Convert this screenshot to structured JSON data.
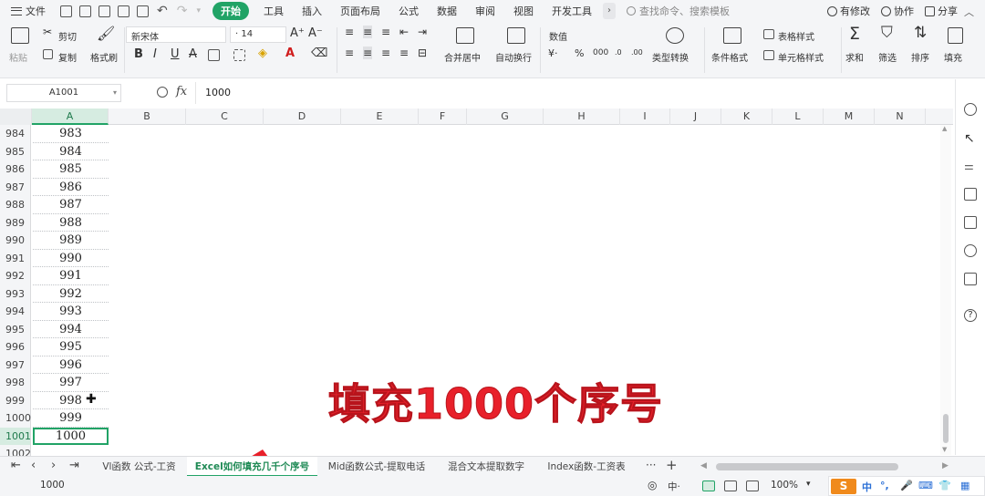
{
  "menubar": {
    "file": "文件",
    "tabs": [
      "开始",
      "工具",
      "插入",
      "页面布局",
      "公式",
      "数据",
      "审阅",
      "视图",
      "开发工具"
    ],
    "search_placeholder": "查找命令、搜索模板",
    "right": [
      "有修改",
      "协作",
      "分享"
    ]
  },
  "ribbon": {
    "paste": "粘贴",
    "cut": "剪切",
    "copy": "复制",
    "format_painter": "格式刷",
    "font_name": "新宋体",
    "font_size": "14",
    "merge_center": "合并居中",
    "wrap_text": "自动换行",
    "number_format": "数值",
    "type_convert": "类型转换",
    "cond_format": "条件格式",
    "table_style": "表格样式",
    "cell_style": "单元格样式",
    "sum": "求和",
    "filter": "筛选",
    "sort": "排序",
    "fill": "填充"
  },
  "formula_bar": {
    "cell_ref": "A1001",
    "fx": "fx",
    "content": "1000"
  },
  "grid": {
    "columns": [
      "A",
      "B",
      "C",
      "D",
      "E",
      "F",
      "G",
      "H",
      "I",
      "J",
      "K",
      "L",
      "M",
      "N"
    ],
    "row_numbers": [
      "984",
      "985",
      "986",
      "987",
      "988",
      "989",
      "990",
      "991",
      "992",
      "993",
      "994",
      "995",
      "996",
      "997",
      "998",
      "999",
      "1000",
      "1001",
      "1002"
    ],
    "col_a_values": [
      "983",
      "984",
      "985",
      "986",
      "987",
      "988",
      "989",
      "990",
      "991",
      "992",
      "993",
      "994",
      "995",
      "996",
      "997",
      "998",
      "999",
      "1000",
      ""
    ]
  },
  "overlay": {
    "headline": "填充1000个序号",
    "arrow_color": "#e8202a"
  },
  "sheet_tabs": [
    "Vl函数 公式-工资",
    "Excel如何填充几千个序号",
    "Mid函数公式-提取电话",
    "混合文本提取数字",
    "Index函数-工资表"
  ],
  "status": {
    "value": "1000",
    "zoom": "100%",
    "ime_lang": "中"
  },
  "colors": {
    "accent": "#21a366",
    "headline": "#e8202a"
  }
}
